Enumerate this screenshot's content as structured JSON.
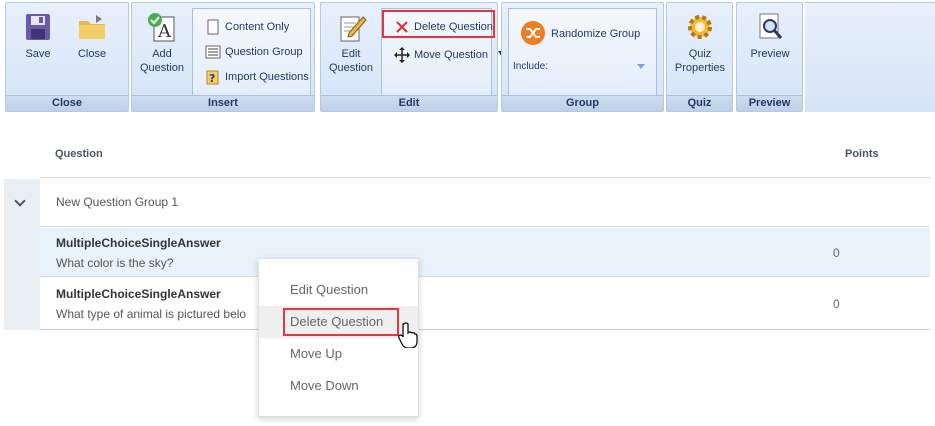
{
  "ribbon": {
    "groups": {
      "close": "Close",
      "insert": "Insert",
      "edit": "Edit",
      "group": "Group",
      "quiz": "Quiz",
      "preview": "Preview"
    },
    "buttons": {
      "save": "Save",
      "close": "Close",
      "add_question_1": "Add",
      "add_question_2": "Question",
      "content_only": "Content Only",
      "question_group": "Question Group",
      "import_questions": "Import Questions",
      "edit_question_1": "Edit",
      "edit_question_2": "Question",
      "delete_question": "Delete Question",
      "move_question": "Move Question",
      "randomize_group": "Randomize Group",
      "include": "Include:",
      "quiz_properties_1": "Quiz",
      "quiz_properties_2": "Properties",
      "preview": "Preview"
    }
  },
  "grid": {
    "headers": {
      "question": "Question",
      "points": "Points"
    },
    "group_name": "New Question Group 1",
    "rows": [
      {
        "type": "MultipleChoiceSingleAnswer",
        "text": "What color is the sky?",
        "points": "0"
      },
      {
        "type": "MultipleChoiceSingleAnswer",
        "text": "What type of animal is pictured belo",
        "points": "0"
      }
    ]
  },
  "context_menu": {
    "items": [
      "Edit Question",
      "Delete Question",
      "Move Up",
      "Move Down"
    ]
  },
  "colors": {
    "highlight_red": "#e0383e",
    "ribbon_blue": "#d5e4f7",
    "selected_row": "#e8f2fb"
  }
}
